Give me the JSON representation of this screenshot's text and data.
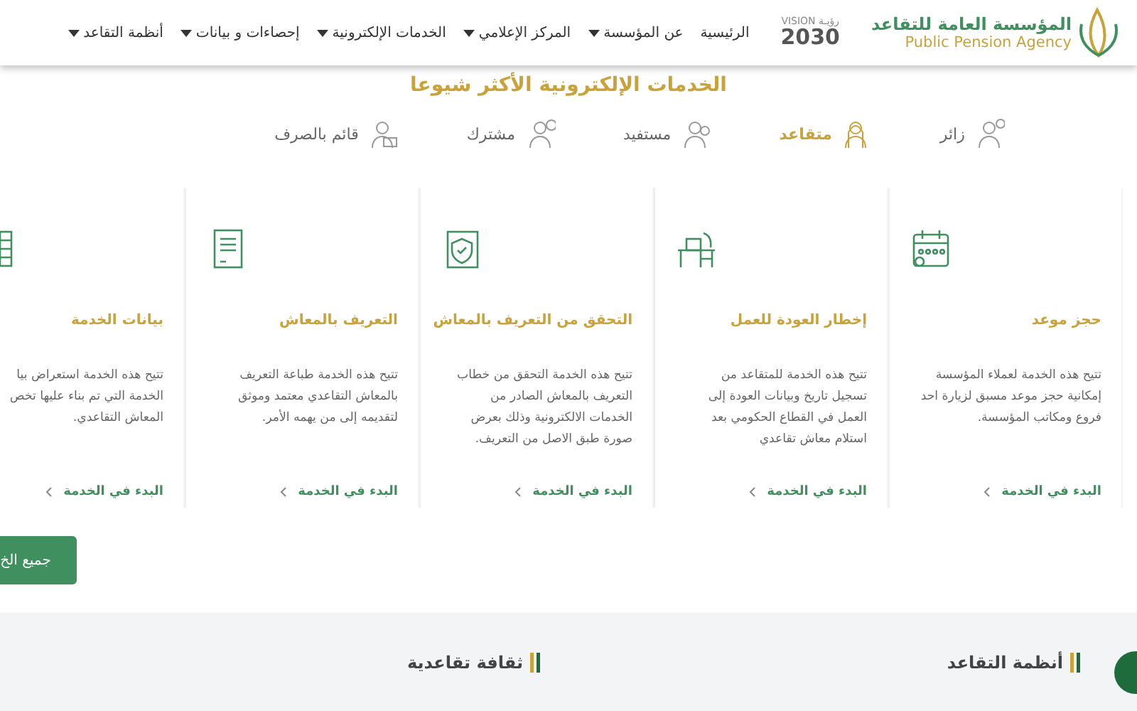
{
  "header": {
    "logo": {
      "arabic": "المؤسسة العامة للتقاعد",
      "english": "Public Pension Agency"
    },
    "vision": {
      "arabic": "رؤيـة",
      "label": "VISION",
      "year": "2030"
    },
    "nav": [
      {
        "label": "الرئيسية",
        "has_menu": false
      },
      {
        "label": "عن المؤسسة",
        "has_menu": true
      },
      {
        "label": "المركز الإعلامي",
        "has_menu": true
      },
      {
        "label": "الخدمات الإلكترونية",
        "has_menu": true
      },
      {
        "label": "إحصاءات و بيانات",
        "has_menu": true
      },
      {
        "label": "أنظمة التقاعد",
        "has_menu": true
      }
    ]
  },
  "section_title": "الخدمات الإلكترونية الأكثر شيوعا",
  "roles": [
    {
      "label": "زائر",
      "selected": false,
      "kind": "visitor"
    },
    {
      "label": "متقاعد",
      "selected": true,
      "kind": "retiree"
    },
    {
      "label": "مستفيد",
      "selected": false,
      "kind": "beneficiary"
    },
    {
      "label": "مشترك",
      "selected": false,
      "kind": "subscriber"
    },
    {
      "label": "قائم بالصرف",
      "selected": false,
      "kind": "payer"
    }
  ],
  "services": [
    {
      "kind": "calendar",
      "title": "حجز موعد",
      "lines": [
        "تتيح هذه الخدمة لعملاء المؤسسة",
        "إمكانية حجز موعد مسبق لزيارة احد",
        "فروع ومكاتب المؤسسة."
      ],
      "link": "البدء في الخدمة"
    },
    {
      "kind": "desk",
      "title": "إخطار العودة للعمل",
      "lines": [
        "تتيح هذه الخدمة للمتقاعد من",
        "تسجيل تاريخ وبيانات العودة إلى",
        "العمل في القطاع الحكومي بعد",
        "استلام معاش تقاعدي"
      ],
      "link": "البدء في الخدمة"
    },
    {
      "kind": "shield",
      "title": "التحقق من التعريف بالمعاش",
      "lines": [
        "تتيح هذه الخدمة التحقق من خطاب",
        "التعريف بالمعاش الصادر من",
        "الخدمات الالكترونية وذلك بعرض",
        "صورة طبق الاصل من التعريف."
      ],
      "link": "البدء في الخدمة"
    },
    {
      "kind": "document",
      "title": "التعريف بالمعاش",
      "lines": [
        "تتيح هذه الخدمة طباعة التعريف",
        "بالمعاش التقاعدي معتمد وموثق",
        "لتقديمه إلى من يهمه الأمر."
      ],
      "link": "البدء في الخدمة"
    },
    {
      "kind": "sheet",
      "title": "بيانات الخدمة",
      "lines": [
        "تتيح هذه الخدمة استعراض بيا",
        "الخدمة التي تم بناء عليها تخص",
        "المعاش التقاعدي."
      ],
      "link": "البدء في الخدمة"
    }
  ],
  "all_services_button": "جميع الخ",
  "bottom_sections": [
    {
      "title": "أنظمة التقاعد"
    },
    {
      "title": "ثقافة تقاعدية"
    }
  ]
}
